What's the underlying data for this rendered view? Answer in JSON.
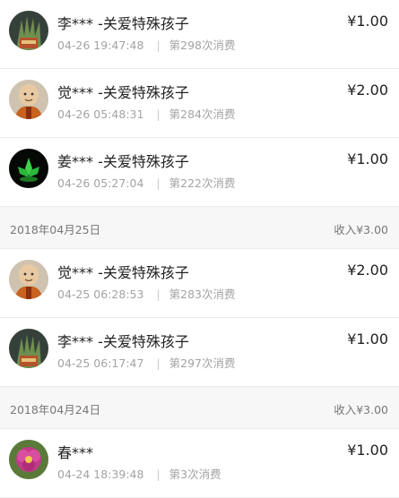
{
  "transactions": [
    {
      "type": "item",
      "name": "李*** -关爱特殊孩子",
      "time": "04-26 19:47:48",
      "count": "第298次消费",
      "amount": "¥1.00",
      "avatar": "plant-avatar"
    },
    {
      "type": "item",
      "name": "觉*** -关爱特殊孩子",
      "time": "04-26 05:48:31",
      "count": "第284次消费",
      "amount": "¥2.00",
      "avatar": "monk-avatar"
    },
    {
      "type": "item",
      "name": "姜*** -关爱特殊孩子",
      "time": "04-26 05:27:04",
      "count": "第222次消费",
      "amount": "¥1.00",
      "avatar": "green-lotus-avatar"
    },
    {
      "type": "day",
      "date": "2018年04月25日",
      "sum": "收入¥3.00"
    },
    {
      "type": "item",
      "name": "觉*** -关爱特殊孩子",
      "time": "04-25 06:28:53",
      "count": "第283次消费",
      "amount": "¥2.00",
      "avatar": "monk-avatar"
    },
    {
      "type": "item",
      "name": "李*** -关爱特殊孩子",
      "time": "04-25 06:17:47",
      "count": "第297次消费",
      "amount": "¥1.00",
      "avatar": "plant-avatar"
    },
    {
      "type": "day",
      "date": "2018年04月24日",
      "sum": "收入¥3.00"
    },
    {
      "type": "item",
      "name": "春***",
      "time": "04-24 18:39:48",
      "count": "第3次消费",
      "amount": "¥1.00",
      "avatar": "flower-avatar"
    }
  ]
}
